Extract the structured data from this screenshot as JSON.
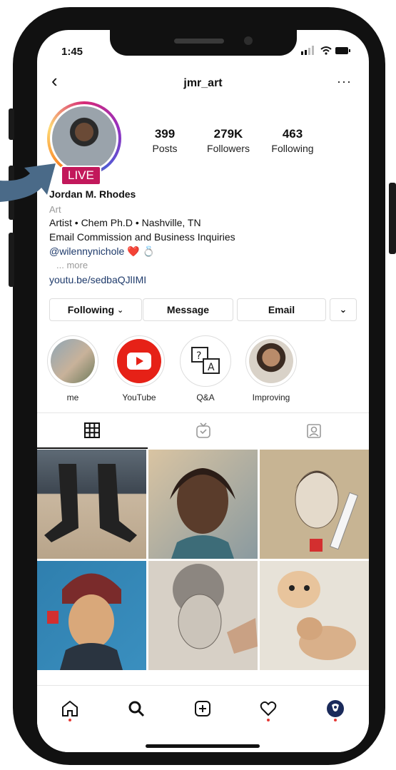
{
  "status": {
    "time": "1:45"
  },
  "header": {
    "username": "jmr_art"
  },
  "profile": {
    "live_label": "LIVE",
    "stats": [
      {
        "value": "399",
        "label": "Posts"
      },
      {
        "value": "279K",
        "label": "Followers"
      },
      {
        "value": "463",
        "label": "Following"
      }
    ],
    "name": "Jordan M. Rhodes",
    "category": "Art",
    "bio_line1": "Artist • Chem Ph.D • Nashville, TN",
    "bio_line2": "Email Commission and Business Inquiries",
    "bio_mention": "@wilennynichole",
    "more": "... more",
    "link": "youtu.be/sedbaQJlIMI"
  },
  "actions": {
    "following": "Following",
    "message": "Message",
    "email": "Email"
  },
  "highlights": [
    {
      "label": "me"
    },
    {
      "label": "YouTube"
    },
    {
      "label": "Q&A"
    },
    {
      "label": "Improving"
    }
  ],
  "colors": {
    "live": "#c2185b",
    "accent_link": "#1e3a6b",
    "notification_dot": "#e53935"
  }
}
